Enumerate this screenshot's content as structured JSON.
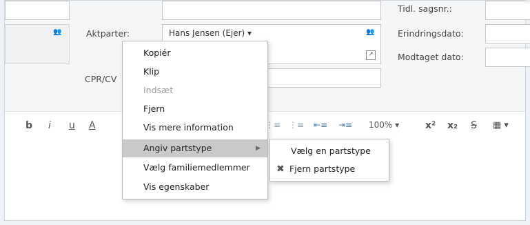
{
  "form": {
    "aktparter_label": "Aktparter:",
    "party_value": "Hans Jensen (Ejer)",
    "cpr_label": "CPR/CV",
    "tidl_label": "Tidl. sagsnr.:",
    "erindring_label": "Erindringsdato:",
    "modtaget_label": "Modtaget dato:"
  },
  "toolbar": {
    "bold": "b",
    "italic": "i",
    "underline": "u",
    "font_color": "A",
    "zoom": "100%",
    "superscript": "x²",
    "subscript": "x₂",
    "strike": "S"
  },
  "context_menu": {
    "items": [
      {
        "label": "Kopiér",
        "enabled": true
      },
      {
        "label": "Klip",
        "enabled": true
      },
      {
        "label": "Indsæt",
        "enabled": false
      },
      {
        "label": "Fjern",
        "enabled": true
      },
      {
        "label": "Vis mere information",
        "enabled": true
      },
      {
        "label": "Angiv partstype",
        "enabled": true,
        "submenu": true
      },
      {
        "label": "Vælg familiemedlemmer",
        "enabled": true
      },
      {
        "label": "Vis egenskaber",
        "enabled": true
      }
    ]
  },
  "submenu": {
    "items": [
      {
        "label": "Vælg en partstype",
        "icon": ""
      },
      {
        "label": "Fjern partstype",
        "icon": "remove-x-icon"
      }
    ]
  }
}
